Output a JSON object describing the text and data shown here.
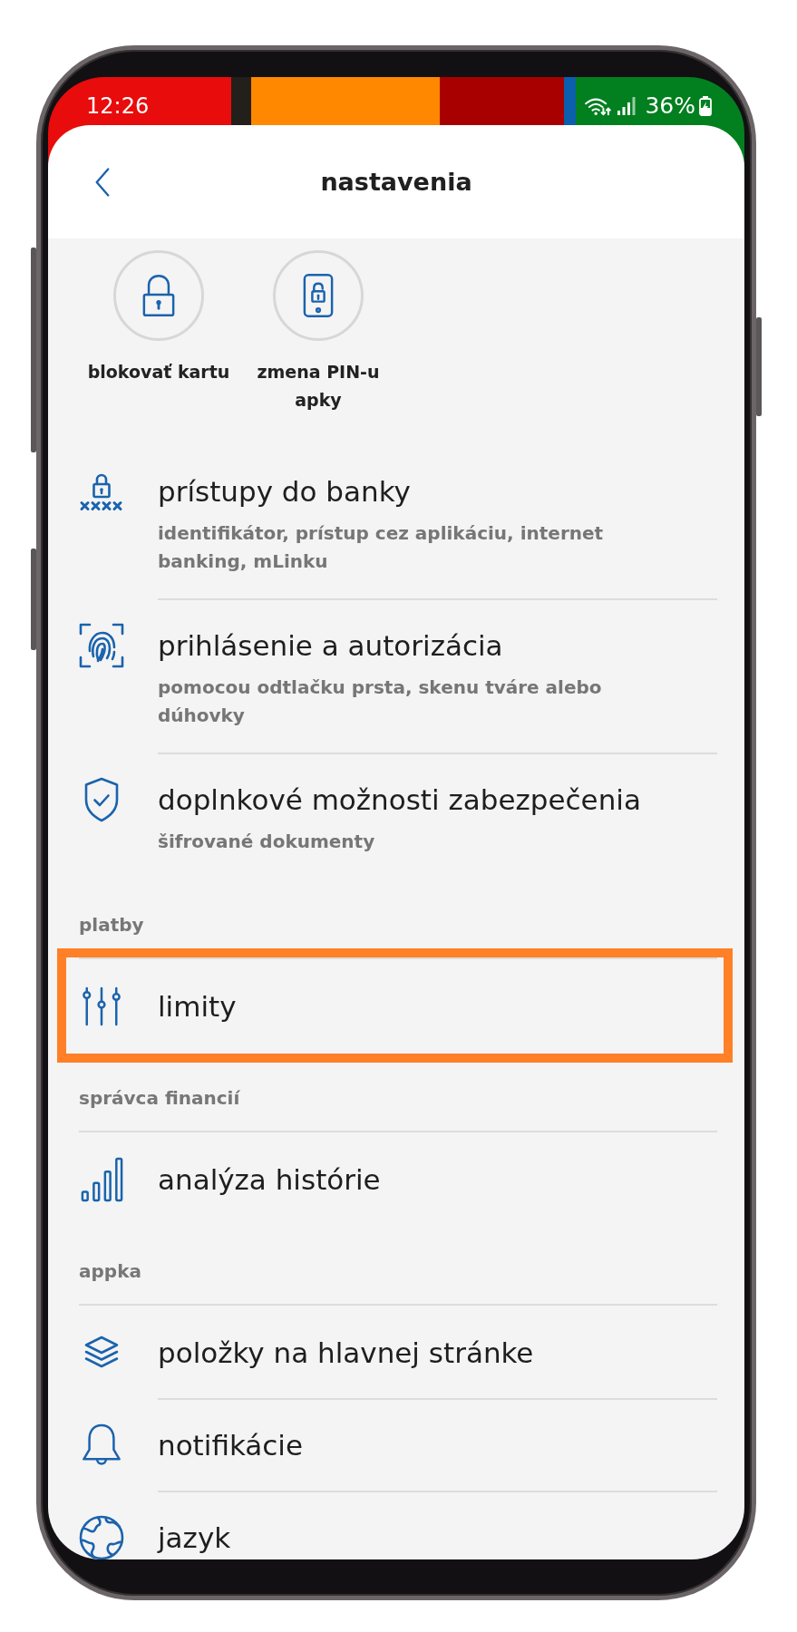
{
  "status_bar": {
    "time": "12:26",
    "battery": "36%"
  },
  "header": {
    "title": "nastavenia"
  },
  "shortcuts": [
    {
      "label": "blokovať kartu"
    },
    {
      "label": "zmena PIN-u apky"
    }
  ],
  "sections": [
    {
      "items": [
        {
          "title": "prístupy do banky",
          "subtitle": "identifikátor, prístup cez aplikáciu, internet banking, mLinku",
          "highlighted": false
        },
        {
          "title": "prihlásenie a autorizácia",
          "subtitle": "pomocou odtlačku prsta, skenu tváre alebo dúhovky",
          "highlighted": false
        },
        {
          "title": "doplnkové možnosti zabezpečenia",
          "subtitle": "šifrované dokumenty",
          "highlighted": false
        }
      ]
    },
    {
      "heading": "platby",
      "items": [
        {
          "title": "limity",
          "highlighted": true
        }
      ]
    },
    {
      "heading": "správca financií",
      "items": [
        {
          "title": "analýza histórie",
          "highlighted": false
        }
      ]
    },
    {
      "heading": "appka",
      "items": [
        {
          "title": "položky na hlavnej stránke",
          "highlighted": false
        },
        {
          "title": "notifikácie",
          "highlighted": false
        },
        {
          "title": "jazyk",
          "highlighted": false
        }
      ]
    }
  ]
}
